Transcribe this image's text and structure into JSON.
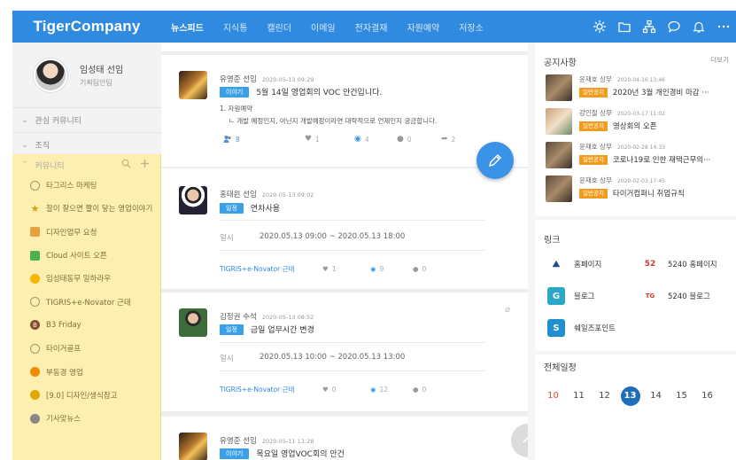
{
  "header": {
    "brand": "TigerCompany",
    "nav": [
      "뉴스피드",
      "지식통",
      "캘린더",
      "이메일",
      "전자결재",
      "자원예약",
      "저장소"
    ]
  },
  "sidebar": {
    "profile": {
      "name": "임성태 선임",
      "team": "기획팀안팀"
    },
    "sections": [
      "관심 커뮤니티",
      "조직"
    ],
    "community_label": "커뮤니티",
    "communities": [
      "타그리스 마케팅",
      "찰이 잘으면 짤이 닿는 영업이야기",
      "디자인업무 요청",
      "Cloud 사이트 오픈",
      "임성태동무 일하라우",
      "TIGRIS+e-Novator 근태",
      "B3 Friday",
      "타이거골프",
      "부동경 영업",
      "[9.0] 디자인/생식참고",
      "기사맞뉴스"
    ]
  },
  "feed": {
    "top_hint": "",
    "posts": [
      {
        "author": "유영준 선임",
        "time": "2020-05-13 09:29",
        "tag": "이야기",
        "title": "5월 14일 영업회의 VOC 안건입니다.",
        "body_1": "1. 자원예약",
        "body_2": "ㄴ 개발 예정인지, 아닌지 개발예정이라면 대략적으로 언제인지 궁금합니다.",
        "people": "8",
        "likes": "1",
        "views": "4",
        "comments": "0",
        "shares": "2"
      },
      {
        "author": "홍태윈 선임",
        "time": "2020-05-13 09:02",
        "tag": "일정",
        "title": "연차사용",
        "sched_label": "일시",
        "sched_value": "2020.05.13 09:00 ~ 2020.05.13 18:00",
        "source": "TIGRIS+e-Novator 근태",
        "likes": "1",
        "views": "9",
        "comments": "0"
      },
      {
        "author": "김정권 수석",
        "time": "2020-05-13 08:52",
        "tag": "일정",
        "title": "금일 업무시간 변경",
        "sched_label": "일시",
        "sched_value": "2020.05.13 10:00 ~ 2020.05.13 13:00",
        "source": "TIGRIS+e-Novator 근태",
        "likes": "0",
        "views": "12",
        "comments": "0"
      },
      {
        "author": "유영준 선임",
        "time": "2020-05-11 13:28",
        "tag": "이야기",
        "title": "목요일 영업VOC회의 안건"
      }
    ]
  },
  "right": {
    "notices_title": "공지사항",
    "notices_more": "더보기",
    "notices": [
      {
        "author": "윤재호 상무",
        "time": "2020-04-16 13:46",
        "tag": "일반공지",
        "title": "2020년 3월 개인경비 마감 ···"
      },
      {
        "author": "강인철 상무",
        "time": "2020-03-17 11:02",
        "tag": "일반공지",
        "title": "영상회의 오픈"
      },
      {
        "author": "윤재호 상무",
        "time": "2020-02-28 14:33",
        "tag": "일반공지",
        "title": "코로나19로 인한 재택근무의···"
      },
      {
        "author": "윤재호 상무",
        "time": "2020-02-03 17:45",
        "tag": "일반공지",
        "title": "타이거컴퍼니 취업규칙"
      }
    ],
    "links_title": "링크",
    "links": [
      "홈페이지",
      "5240 홈페이지",
      "블로그",
      "5240 블로그",
      "쉐일즈포인트"
    ],
    "schedule_title": "전체일정",
    "days": [
      "10",
      "11",
      "12",
      "13",
      "14",
      "15",
      "16"
    ],
    "today": "13"
  }
}
